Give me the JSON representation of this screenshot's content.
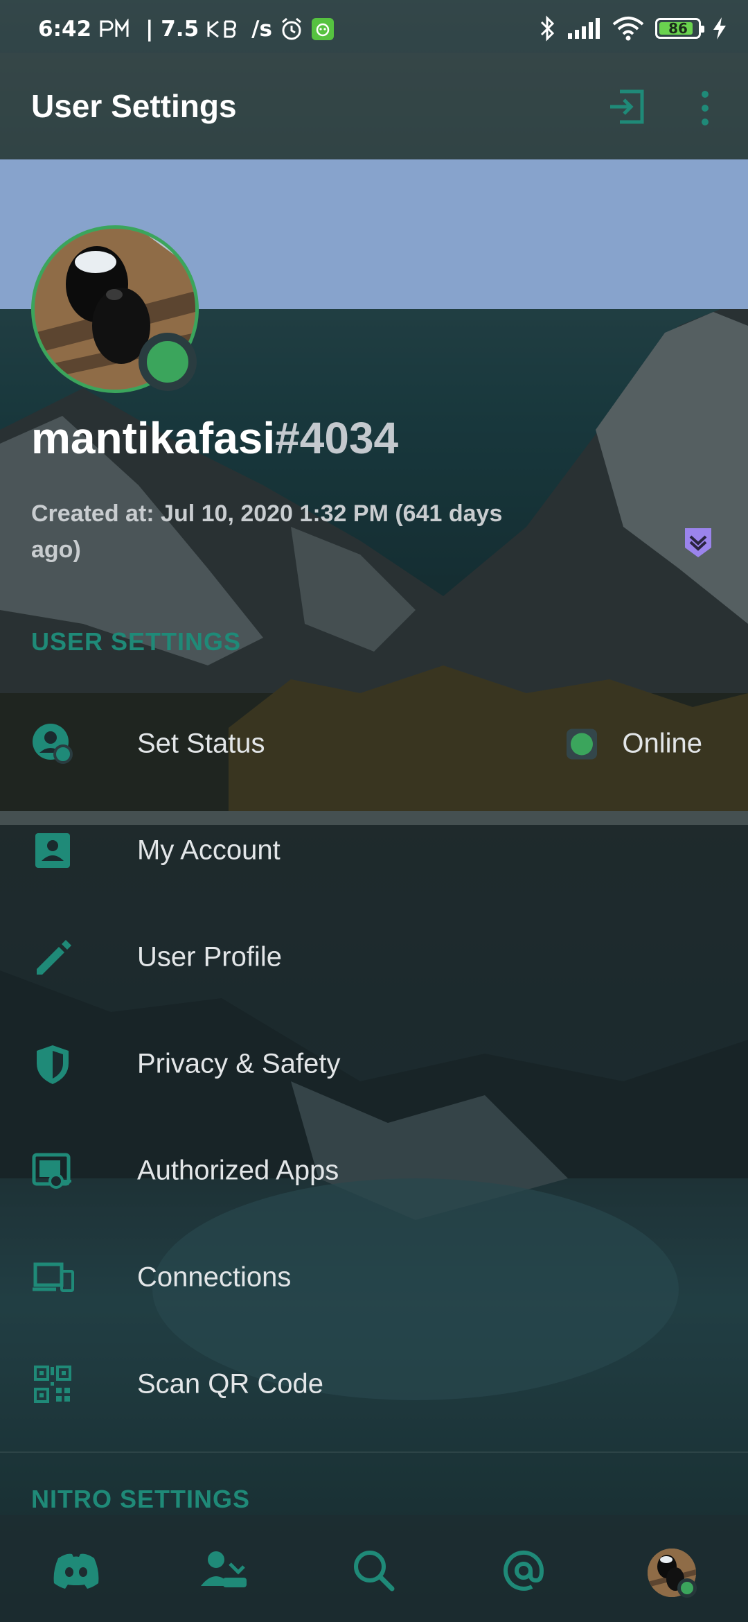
{
  "status_bar": {
    "time": "6:42",
    "ampm_icon": "pm-glyph-icon",
    "speed": "| 7.5",
    "speed_unit_icon": "kb-glyph-icon",
    "speed_suffix": "/s",
    "battery_level": "86"
  },
  "app_bar": {
    "title": "User Settings"
  },
  "profile": {
    "username": "mantikafasi",
    "discriminator": "#4034",
    "created": "Created at: Jul 10, 2020 1:32 PM (641 days ago)",
    "status_color": "#3ba55c"
  },
  "sections": {
    "user_settings": "USER SETTINGS",
    "nitro_settings": "NITRO SETTINGS"
  },
  "menu": [
    {
      "label": "Set Status",
      "icon": "set-status-icon"
    },
    {
      "label": "My Account",
      "icon": "account-icon"
    },
    {
      "label": "User Profile",
      "icon": "pencil-icon"
    },
    {
      "label": "Privacy & Safety",
      "icon": "shield-icon"
    },
    {
      "label": "Authorized Apps",
      "icon": "authorized-apps-icon"
    },
    {
      "label": "Connections",
      "icon": "devices-icon"
    },
    {
      "label": "Scan QR Code",
      "icon": "qr-code-icon"
    }
  ],
  "status_value": "Online",
  "colors": {
    "accent": "#1f8a78",
    "online": "#3ba55c",
    "banner": "#87a3cc"
  },
  "bottom_nav": [
    "discord-home-icon",
    "friends-icon",
    "search-icon",
    "mentions-icon",
    "profile-avatar"
  ]
}
